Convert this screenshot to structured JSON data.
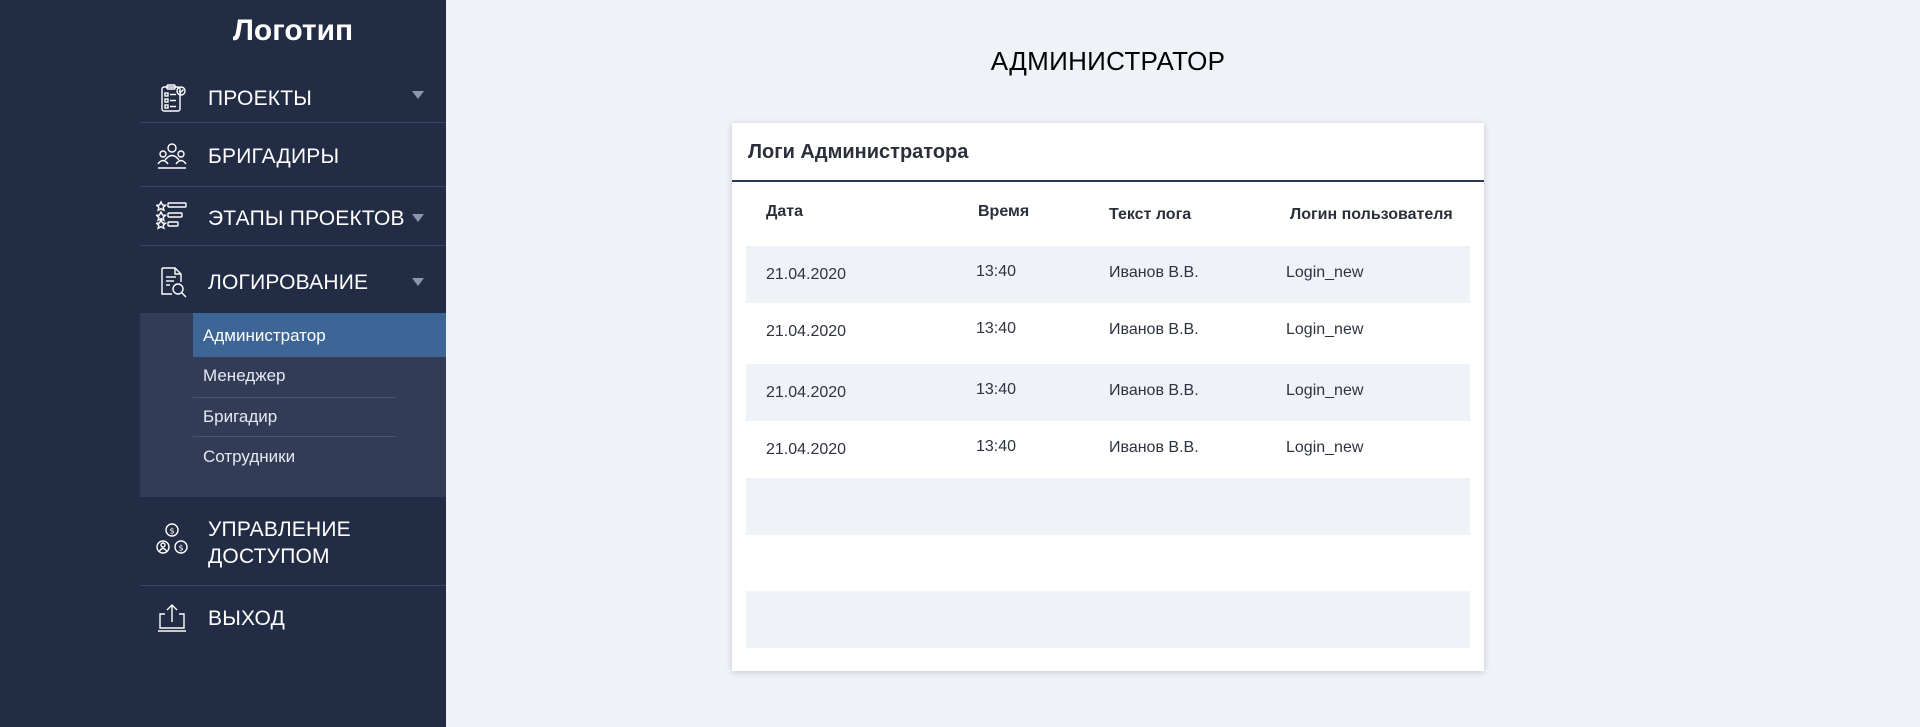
{
  "sidebar": {
    "logo": "Логотип",
    "items": [
      {
        "label": "ПРОЕКТЫ",
        "icon": "clipboard-icon"
      },
      {
        "label": "БРИГАДИРЫ",
        "icon": "team-icon"
      },
      {
        "label": "ЭТАПЫ ПРОЕКТОВ",
        "icon": "stages-list-icon"
      },
      {
        "label": "ЛОГИРОВАНИЕ",
        "icon": "document-search-icon"
      },
      {
        "label": "УПРАВЛЕНИЕ",
        "label2": "ДОСТУПОМ",
        "icon": "access-users-icon"
      },
      {
        "label": "ВЫХОД",
        "icon": "logout-icon"
      }
    ],
    "submenu": [
      "Администратор",
      "Менеджер",
      "Бригадир",
      "Сотрудники"
    ]
  },
  "main": {
    "title": "АДМИНИСТРАТОР",
    "card_title": "Логи Администратора",
    "columns": [
      "Дата",
      "Время",
      "Текст лога",
      "Логин пользователя"
    ],
    "rows": [
      [
        "21.04.2020",
        "13:40",
        "Иванов В.В.",
        "Login_new"
      ],
      [
        "21.04.2020",
        "13:40",
        "Иванов В.В.",
        "Login_new"
      ],
      [
        "21.04.2020",
        "13:40",
        "Иванов В.В.",
        "Login_new"
      ],
      [
        "21.04.2020",
        "13:40",
        "Иванов В.В.",
        "Login_new"
      ]
    ]
  },
  "colors": {
    "sidebar_bg": "#232c45",
    "submenu_bg": "#333c57",
    "active_item": "#3d6595",
    "page_bg": "#eff2f7",
    "row_shade": "#eff2f7"
  }
}
